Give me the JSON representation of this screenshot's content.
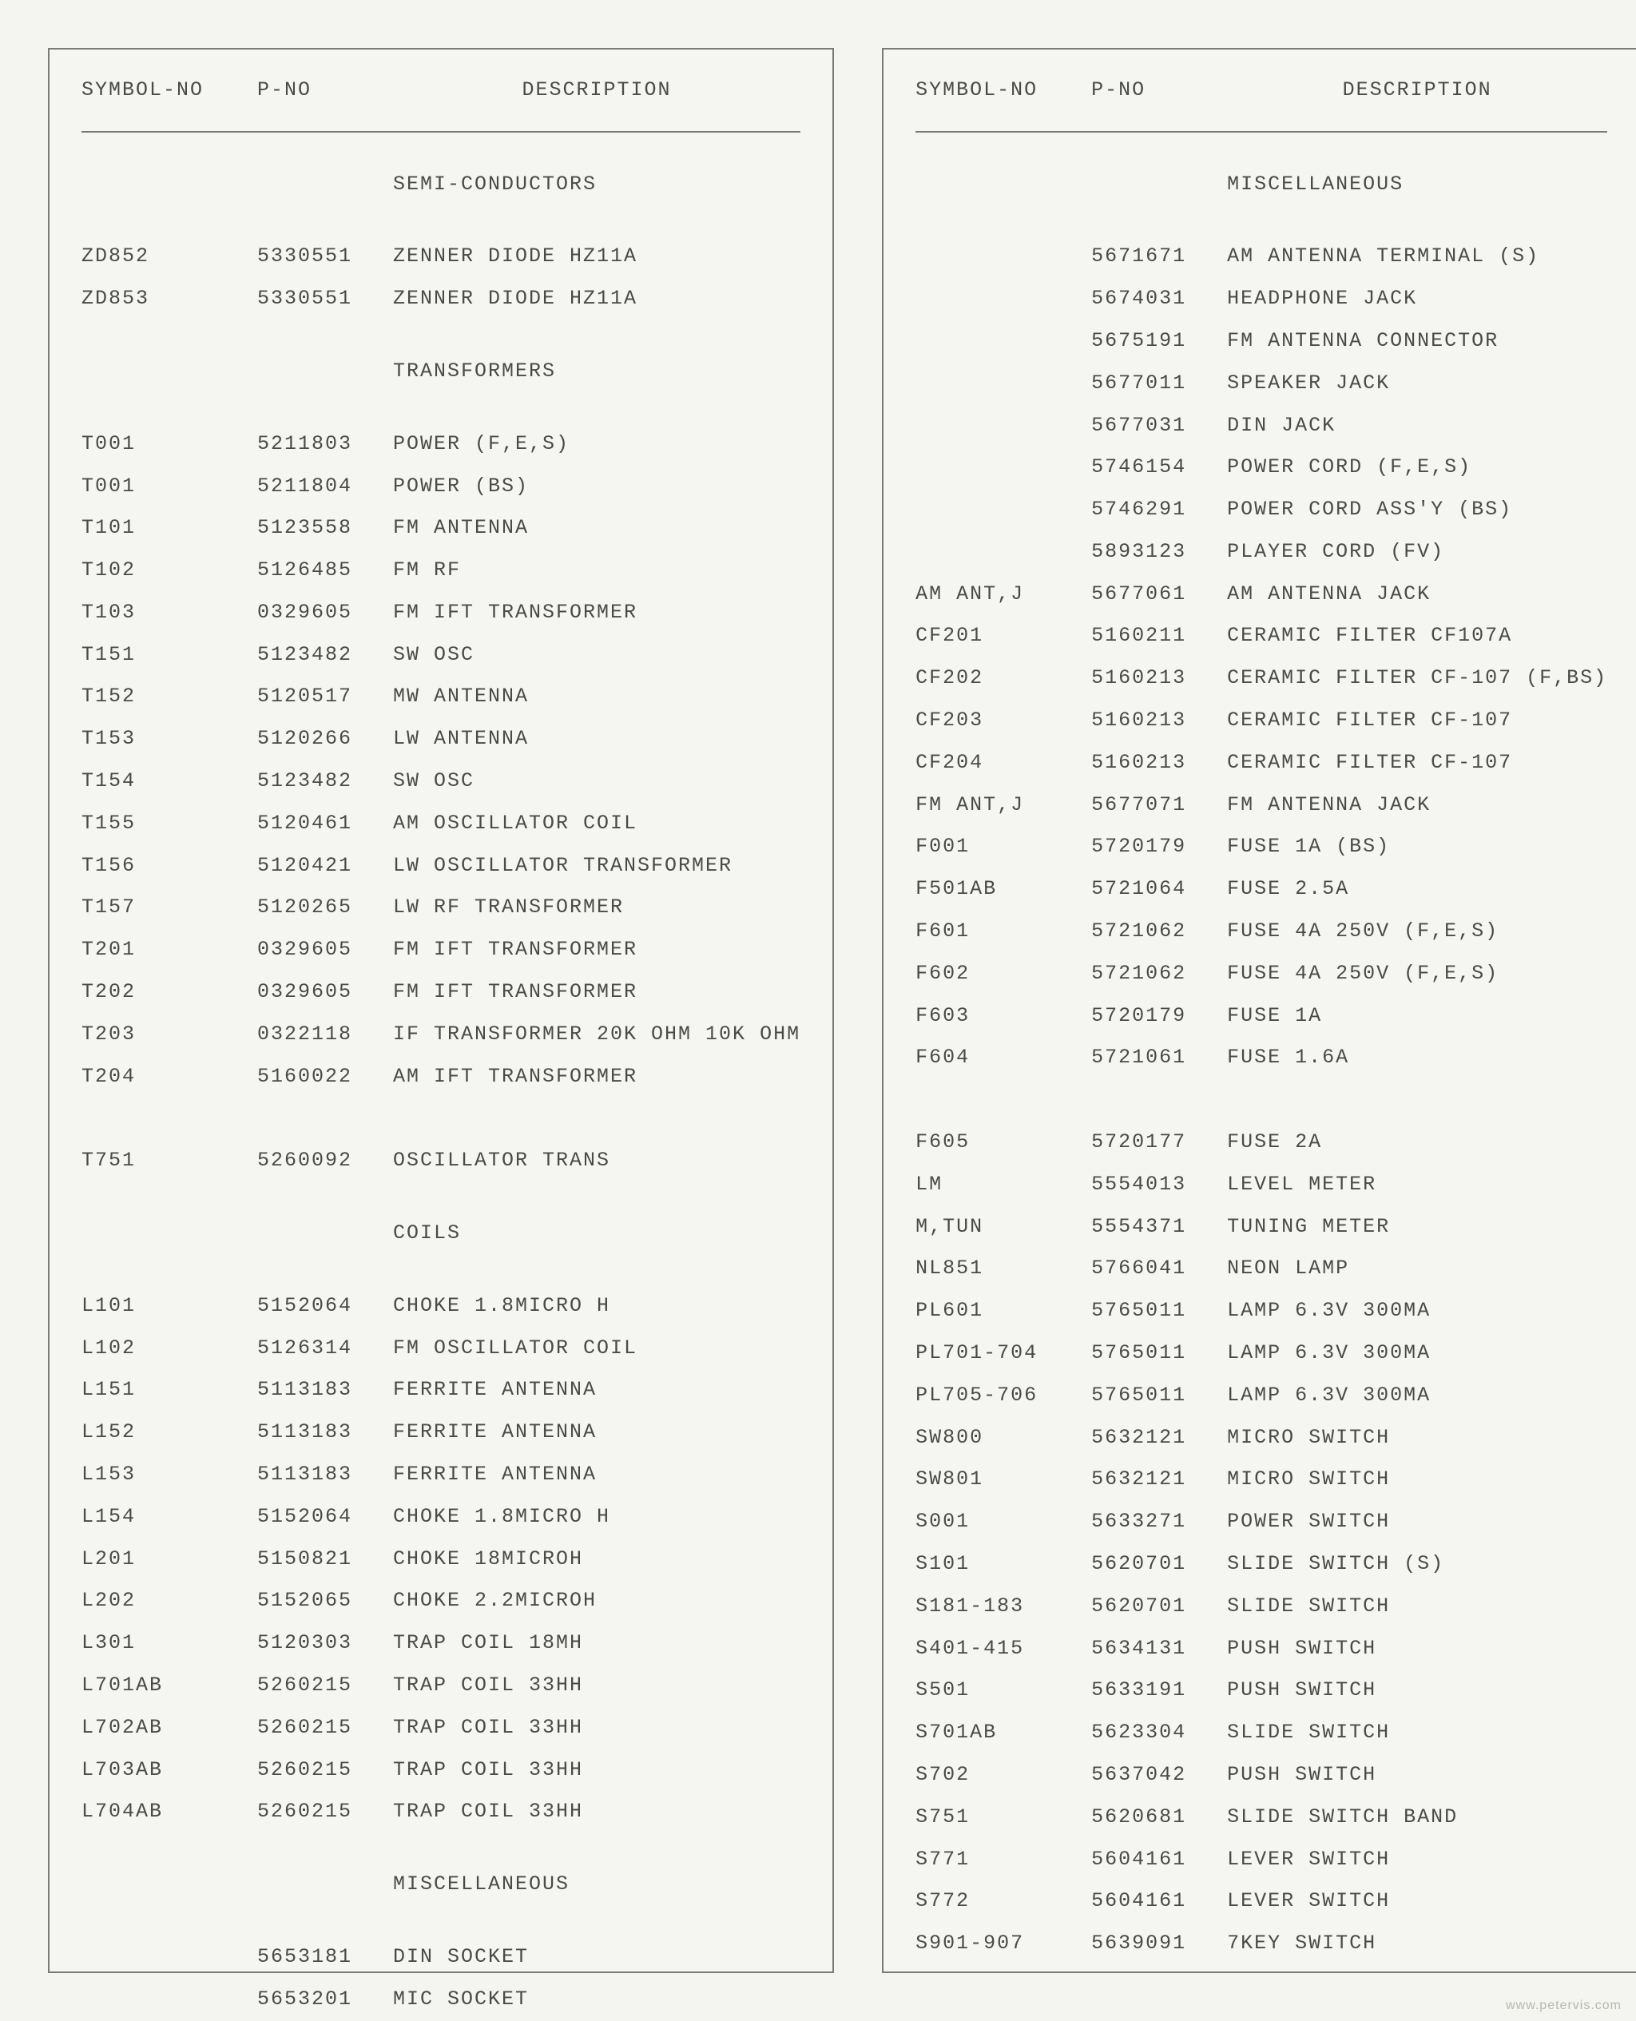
{
  "headers": {
    "symbol": "SYMBOL-NO",
    "pno": "P-NO",
    "desc": "DESCRIPTION"
  },
  "footer": "www.petervis.com",
  "left": [
    {
      "type": "section",
      "desc": "SEMI-CONDUCTORS"
    },
    {
      "type": "row",
      "symbol": "ZD852",
      "pno": "5330551",
      "desc": "ZENNER DIODE HZ11A"
    },
    {
      "type": "row",
      "symbol": "ZD853",
      "pno": "5330551",
      "desc": "ZENNER DIODE HZ11A"
    },
    {
      "type": "section",
      "desc": "TRANSFORMERS"
    },
    {
      "type": "row",
      "symbol": "T001",
      "pno": "5211803",
      "desc": "POWER (F,E,S)"
    },
    {
      "type": "row",
      "symbol": "T001",
      "pno": "5211804",
      "desc": "POWER (BS)"
    },
    {
      "type": "row",
      "symbol": "T101",
      "pno": "5123558",
      "desc": "FM ANTENNA"
    },
    {
      "type": "row",
      "symbol": "T102",
      "pno": "5126485",
      "desc": "FM RF"
    },
    {
      "type": "row",
      "symbol": "T103",
      "pno": "0329605",
      "desc": "FM IFT TRANSFORMER"
    },
    {
      "type": "row",
      "symbol": "T151",
      "pno": "5123482",
      "desc": "SW OSC"
    },
    {
      "type": "row",
      "symbol": "T152",
      "pno": "5120517",
      "desc": "MW ANTENNA"
    },
    {
      "type": "row",
      "symbol": "T153",
      "pno": "5120266",
      "desc": "LW ANTENNA"
    },
    {
      "type": "row",
      "symbol": "T154",
      "pno": "5123482",
      "desc": "SW OSC"
    },
    {
      "type": "row",
      "symbol": "T155",
      "pno": "5120461",
      "desc": "AM OSCILLATOR COIL"
    },
    {
      "type": "row",
      "symbol": "T156",
      "pno": "5120421",
      "desc": "LW OSCILLATOR TRANSFORMER"
    },
    {
      "type": "row",
      "symbol": "T157",
      "pno": "5120265",
      "desc": "LW RF TRANSFORMER"
    },
    {
      "type": "row",
      "symbol": "T201",
      "pno": "0329605",
      "desc": "FM IFT TRANSFORMER"
    },
    {
      "type": "row",
      "symbol": "T202",
      "pno": "0329605",
      "desc": "FM IFT TRANSFORMER"
    },
    {
      "type": "row",
      "symbol": "T203",
      "pno": "0322118",
      "desc": "IF TRANSFORMER 20K OHM 10K OHM"
    },
    {
      "type": "row",
      "symbol": "T204",
      "pno": "5160022",
      "desc": "AM IFT TRANSFORMER"
    },
    {
      "type": "gap"
    },
    {
      "type": "row",
      "symbol": "T751",
      "pno": "5260092",
      "desc": "OSCILLATOR TRANS"
    },
    {
      "type": "section",
      "desc": "COILS"
    },
    {
      "type": "row",
      "symbol": "L101",
      "pno": "5152064",
      "desc": "CHOKE 1.8MICRO H"
    },
    {
      "type": "row",
      "symbol": "L102",
      "pno": "5126314",
      "desc": "FM OSCILLATOR COIL"
    },
    {
      "type": "row",
      "symbol": "L151",
      "pno": "5113183",
      "desc": "FERRITE ANTENNA"
    },
    {
      "type": "row",
      "symbol": "L152",
      "pno": "5113183",
      "desc": "FERRITE ANTENNA"
    },
    {
      "type": "row",
      "symbol": "L153",
      "pno": "5113183",
      "desc": "FERRITE ANTENNA"
    },
    {
      "type": "row",
      "symbol": "L154",
      "pno": "5152064",
      "desc": "CHOKE 1.8MICRO H"
    },
    {
      "type": "row",
      "symbol": "L201",
      "pno": "5150821",
      "desc": "CHOKE 18MICROH"
    },
    {
      "type": "row",
      "symbol": "L202",
      "pno": "5152065",
      "desc": "CHOKE 2.2MICROH"
    },
    {
      "type": "row",
      "symbol": "L301",
      "pno": "5120303",
      "desc": "TRAP COIL 18MH"
    },
    {
      "type": "row",
      "symbol": "L701AB",
      "pno": "5260215",
      "desc": "TRAP COIL 33HH"
    },
    {
      "type": "row",
      "symbol": "L702AB",
      "pno": "5260215",
      "desc": "TRAP COIL 33HH"
    },
    {
      "type": "row",
      "symbol": "L703AB",
      "pno": "5260215",
      "desc": "TRAP COIL 33HH"
    },
    {
      "type": "row",
      "symbol": "L704AB",
      "pno": "5260215",
      "desc": "TRAP COIL 33HH"
    },
    {
      "type": "section",
      "desc": "MISCELLANEOUS"
    },
    {
      "type": "row",
      "symbol": "",
      "pno": "5653181",
      "desc": "DIN SOCKET"
    },
    {
      "type": "row",
      "symbol": "",
      "pno": "5653201",
      "desc": "MIC SOCKET"
    }
  ],
  "right": [
    {
      "type": "section",
      "desc": "MISCELLANEOUS"
    },
    {
      "type": "row",
      "symbol": "",
      "pno": "5671671",
      "desc": "AM ANTENNA TERMINAL (S)"
    },
    {
      "type": "row",
      "symbol": "",
      "pno": "5674031",
      "desc": "HEADPHONE JACK"
    },
    {
      "type": "row",
      "symbol": "",
      "pno": "5675191",
      "desc": "FM ANTENNA CONNECTOR"
    },
    {
      "type": "row",
      "symbol": "",
      "pno": "5677011",
      "desc": "SPEAKER JACK"
    },
    {
      "type": "row",
      "symbol": "",
      "pno": "5677031",
      "desc": "DIN JACK"
    },
    {
      "type": "row",
      "symbol": "",
      "pno": "5746154",
      "desc": "POWER CORD (F,E,S)"
    },
    {
      "type": "row",
      "symbol": "",
      "pno": "5746291",
      "desc": "POWER CORD ASS'Y (BS)"
    },
    {
      "type": "row",
      "symbol": "",
      "pno": "5893123",
      "desc": "PLAYER CORD (FV)"
    },
    {
      "type": "row",
      "symbol": "AM ANT,J",
      "pno": "5677061",
      "desc": "AM ANTENNA JACK"
    },
    {
      "type": "row",
      "symbol": "CF201",
      "pno": "5160211",
      "desc": "CERAMIC FILTER CF107A"
    },
    {
      "type": "row",
      "symbol": "CF202",
      "pno": "5160213",
      "desc": "CERAMIC FILTER CF-107 (F,BS)"
    },
    {
      "type": "row",
      "symbol": "CF203",
      "pno": "5160213",
      "desc": "CERAMIC FILTER CF-107"
    },
    {
      "type": "row",
      "symbol": "CF204",
      "pno": "5160213",
      "desc": "CERAMIC FILTER CF-107"
    },
    {
      "type": "row",
      "symbol": "FM ANT,J",
      "pno": "5677071",
      "desc": "FM ANTENNA JACK"
    },
    {
      "type": "row",
      "symbol": "F001",
      "pno": "5720179",
      "desc": "FUSE 1A (BS)"
    },
    {
      "type": "row",
      "symbol": "F501AB",
      "pno": "5721064",
      "desc": "FUSE 2.5A"
    },
    {
      "type": "row",
      "symbol": "F601",
      "pno": "5721062",
      "desc": "FUSE 4A 250V (F,E,S)"
    },
    {
      "type": "row",
      "symbol": "F602",
      "pno": "5721062",
      "desc": "FUSE 4A 250V (F,E,S)"
    },
    {
      "type": "row",
      "symbol": "F603",
      "pno": "5720179",
      "desc": "FUSE 1A"
    },
    {
      "type": "row",
      "symbol": "F604",
      "pno": "5721061",
      "desc": "FUSE 1.6A"
    },
    {
      "type": "gap"
    },
    {
      "type": "row",
      "symbol": "F605",
      "pno": "5720177",
      "desc": "FUSE 2A"
    },
    {
      "type": "row",
      "symbol": "LM",
      "pno": "5554013",
      "desc": "LEVEL METER"
    },
    {
      "type": "row",
      "symbol": "M,TUN",
      "pno": "5554371",
      "desc": "TUNING METER"
    },
    {
      "type": "row",
      "symbol": "NL851",
      "pno": "5766041",
      "desc": "NEON LAMP"
    },
    {
      "type": "row",
      "symbol": "PL601",
      "pno": "5765011",
      "desc": "LAMP 6.3V 300MA"
    },
    {
      "type": "row",
      "symbol": "PL701-704",
      "pno": "5765011",
      "desc": "LAMP 6.3V 300MA"
    },
    {
      "type": "row",
      "symbol": "PL705-706",
      "pno": "5765011",
      "desc": "LAMP 6.3V 300MA"
    },
    {
      "type": "row",
      "symbol": "SW800",
      "pno": "5632121",
      "desc": "MICRO SWITCH"
    },
    {
      "type": "row",
      "symbol": "SW801",
      "pno": "5632121",
      "desc": "MICRO SWITCH"
    },
    {
      "type": "row",
      "symbol": "S001",
      "pno": "5633271",
      "desc": "POWER SWITCH"
    },
    {
      "type": "row",
      "symbol": "S101",
      "pno": "5620701",
      "desc": "SLIDE SWITCH (S)"
    },
    {
      "type": "row",
      "symbol": "S181-183",
      "pno": "5620701",
      "desc": "SLIDE SWITCH"
    },
    {
      "type": "row",
      "symbol": "S401-415",
      "pno": "5634131",
      "desc": "PUSH SWITCH"
    },
    {
      "type": "row",
      "symbol": "S501",
      "pno": "5633191",
      "desc": "PUSH SWITCH"
    },
    {
      "type": "row",
      "symbol": "S701AB",
      "pno": "5623304",
      "desc": "SLIDE SWITCH"
    },
    {
      "type": "row",
      "symbol": "S702",
      "pno": "5637042",
      "desc": "PUSH SWITCH"
    },
    {
      "type": "row",
      "symbol": "S751",
      "pno": "5620681",
      "desc": "SLIDE SWITCH BAND"
    },
    {
      "type": "row",
      "symbol": "S771",
      "pno": "5604161",
      "desc": "LEVER SWITCH"
    },
    {
      "type": "row",
      "symbol": "S772",
      "pno": "5604161",
      "desc": "LEVER SWITCH"
    },
    {
      "type": "row",
      "symbol": "S901-907",
      "pno": "5639091",
      "desc": "7KEY SWITCH"
    }
  ]
}
